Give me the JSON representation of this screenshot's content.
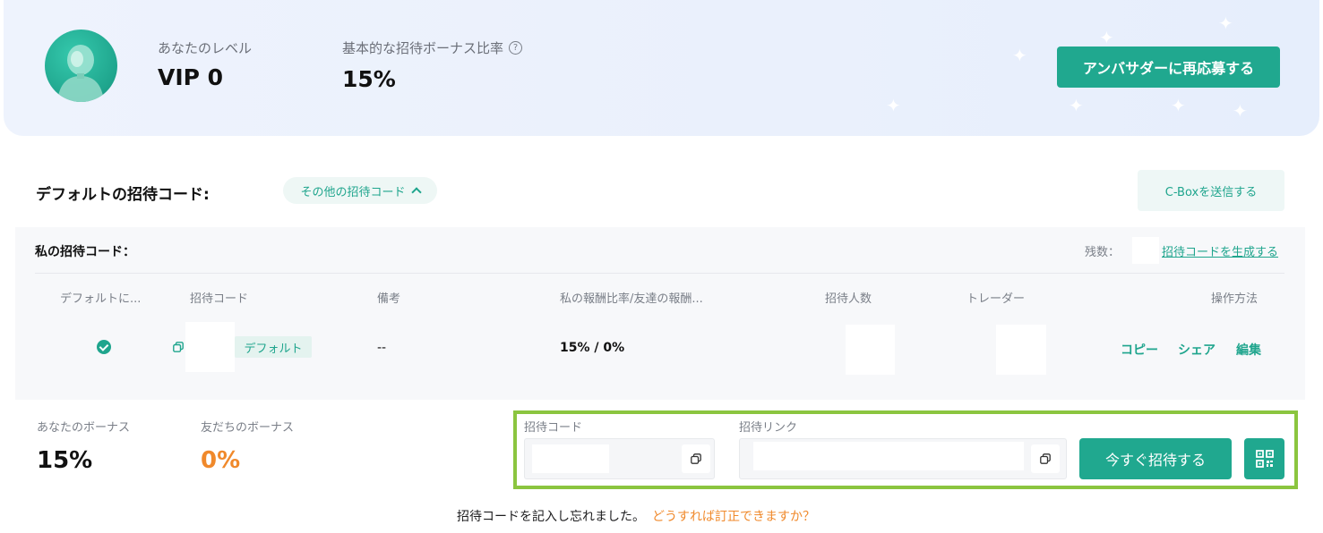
{
  "banner": {
    "level_label": "あなたのレベル",
    "level_value": "VIP 0",
    "rate_label": "基本的な招待ボーナス比率",
    "rate_value": "15%",
    "reapply_label": "アンバサダーに再応募する"
  },
  "default_section": {
    "title": "デフォルトの招待コード:",
    "other_codes_label": "その他の招待コード",
    "cbox_label": "C-Boxを送信する"
  },
  "my_codes": {
    "title": "私の招待コード：",
    "remaining_label": "残数：",
    "generate_label": "招待コードを生成する",
    "columns": [
      "デフォルトに...",
      "招待コード",
      "備考",
      "私の報酬比率/友達の報酬...",
      "招待人数",
      "トレーダー",
      "操作方法"
    ],
    "rows": [
      {
        "is_default": true,
        "badge": "デフォルト",
        "note": "--",
        "ratio": "15% / 0%",
        "actions": [
          "コピー",
          "シェア",
          "編集"
        ]
      }
    ]
  },
  "bonus": {
    "your_label": "あなたのボーナス",
    "your_value": "15%",
    "friend_label": "友だちのボーナス",
    "friend_value": "0%"
  },
  "invite": {
    "code_label": "招待コード",
    "link_label": "招待リンク",
    "invite_now_label": "今すぐ招待する"
  },
  "footer": {
    "note": "招待コードを記入し忘れました。",
    "link": "どうすれば訂正できますか？"
  },
  "colors": {
    "accent": "#20a88f",
    "orange": "#f0892b",
    "highlight_frame": "#8bc53f"
  }
}
